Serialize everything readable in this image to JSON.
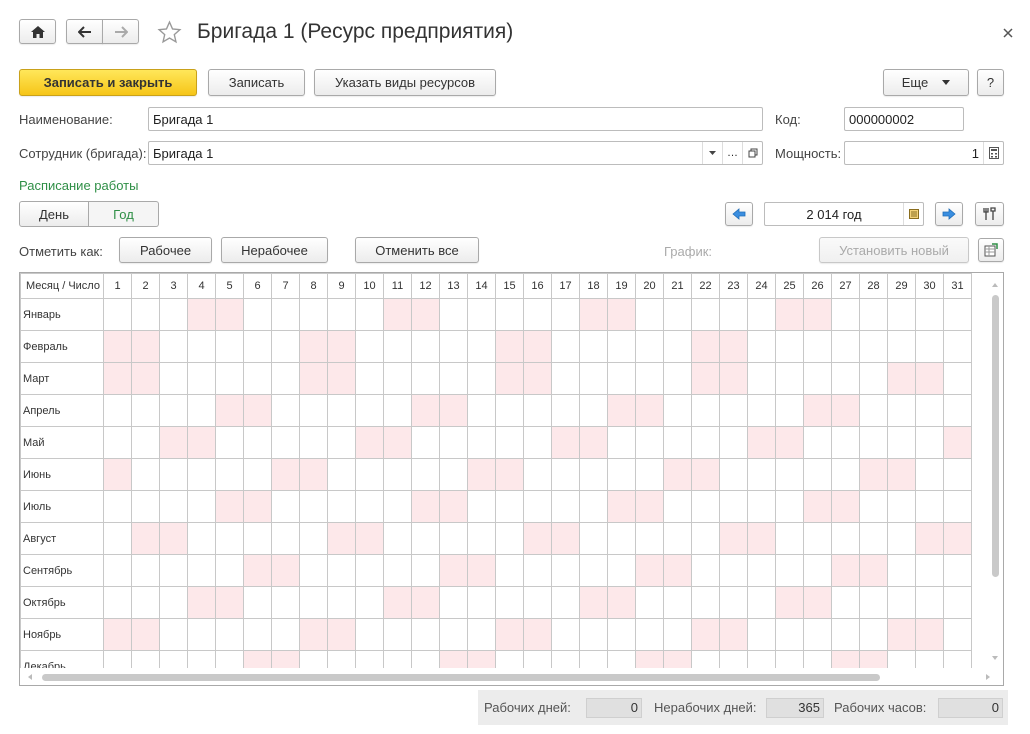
{
  "header": {
    "title": "Бригада 1 (Ресурс предприятия)",
    "icons": [
      "home-icon",
      "back-arrow-icon",
      "forward-arrow-icon",
      "star-icon",
      "close-icon"
    ]
  },
  "toolbar": {
    "save_close": "Записать и закрыть",
    "save": "Записать",
    "resource_types": "Указать виды ресурсов",
    "more": "Еще",
    "help": "?"
  },
  "form": {
    "name_label": "Наименование:",
    "name_value": "Бригада 1",
    "code_label": "Код:",
    "code_value": "000000002",
    "employee_label": "Сотрудник (бригада):",
    "employee_value": "Бригада 1",
    "capacity_label": "Мощность:",
    "capacity_value": "1"
  },
  "schedule": {
    "section_title": "Расписание работы",
    "view_day": "День",
    "view_year": "Год",
    "year_value": "2 014 год",
    "mark_label": "Отметить как:",
    "working": "Рабочее",
    "nonworking": "Нерабочее",
    "cancel_all": "Отменить все",
    "graph_label": "График:",
    "set_new": "Установить новый"
  },
  "calendar": {
    "corner_header": "Месяц / Число",
    "days": [
      "1",
      "2",
      "3",
      "4",
      "5",
      "6",
      "7",
      "8",
      "9",
      "10",
      "11",
      "12",
      "13",
      "14",
      "15",
      "16",
      "17",
      "18",
      "19",
      "20",
      "21",
      "22",
      "23",
      "24",
      "25",
      "26",
      "27",
      "28",
      "29",
      "30",
      "31"
    ],
    "months": [
      {
        "name": "Январь",
        "weekends": [
          4,
          5,
          11,
          12,
          18,
          19,
          25,
          26
        ]
      },
      {
        "name": "Февраль",
        "weekends": [
          1,
          2,
          8,
          9,
          15,
          16,
          22,
          23
        ]
      },
      {
        "name": "Март",
        "weekends": [
          1,
          2,
          8,
          9,
          15,
          16,
          22,
          23,
          29,
          30
        ]
      },
      {
        "name": "Апрель",
        "weekends": [
          5,
          6,
          12,
          13,
          19,
          20,
          26,
          27
        ]
      },
      {
        "name": "Май",
        "weekends": [
          3,
          4,
          10,
          11,
          17,
          18,
          24,
          25,
          31
        ]
      },
      {
        "name": "Июнь",
        "weekends": [
          1,
          7,
          8,
          14,
          15,
          21,
          22,
          28,
          29
        ]
      },
      {
        "name": "Июль",
        "weekends": [
          5,
          6,
          12,
          13,
          19,
          20,
          26,
          27
        ]
      },
      {
        "name": "Август",
        "weekends": [
          2,
          3,
          9,
          10,
          16,
          17,
          23,
          24,
          30,
          31
        ]
      },
      {
        "name": "Сентябрь",
        "weekends": [
          6,
          7,
          13,
          14,
          20,
          21,
          27,
          28
        ]
      },
      {
        "name": "Октябрь",
        "weekends": [
          4,
          5,
          11,
          12,
          18,
          19,
          25,
          26
        ]
      },
      {
        "name": "Ноябрь",
        "weekends": [
          1,
          2,
          8,
          9,
          15,
          16,
          22,
          23,
          29,
          30
        ]
      },
      {
        "name": "Декабрь",
        "weekends": [
          6,
          7,
          13,
          14,
          20,
          21,
          27,
          28
        ]
      }
    ],
    "weekend_color": "#fde8ea"
  },
  "status": {
    "working_days_label": "Рабочих дней:",
    "working_days": "0",
    "nonworking_days_label": "Нерабочих дней:",
    "nonworking_days": "365",
    "working_hours_label": "Рабочих часов:",
    "working_hours": "0"
  }
}
